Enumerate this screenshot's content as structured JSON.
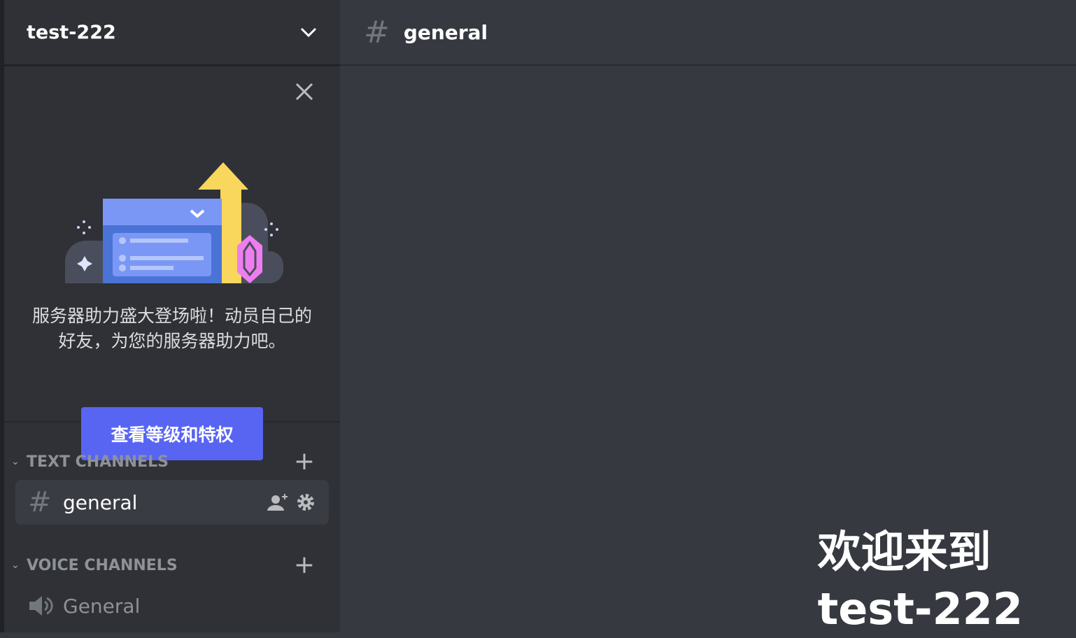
{
  "server": {
    "name": "test-222"
  },
  "boost_card": {
    "text": "服务器助力盛大登场啦！动员自己的好友，为您的服务器助力吧。",
    "button_label": "查看等级和特权"
  },
  "categories": [
    {
      "label": "TEXT CHANNELS",
      "channels": [
        {
          "name": "general",
          "type": "text",
          "active": true
        }
      ]
    },
    {
      "label": "VOICE CHANNELS",
      "channels": [
        {
          "name": "General",
          "type": "voice",
          "active": false
        }
      ]
    }
  ],
  "header": {
    "channel": "general"
  },
  "welcome": {
    "line1": "欢迎来到",
    "line2": "test-222"
  },
  "colors": {
    "accent": "#5865f2",
    "sidebar": "#2f3136",
    "main": "#36393f"
  }
}
